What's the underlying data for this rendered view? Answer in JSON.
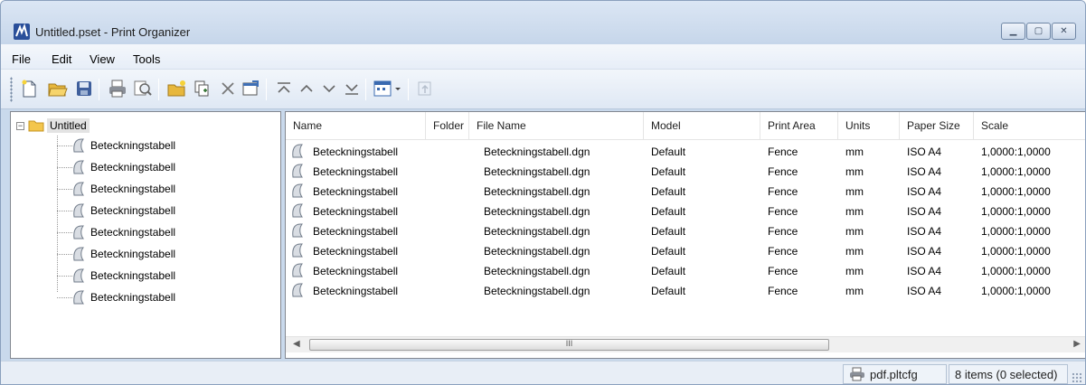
{
  "window": {
    "title": "Untitled.pset - Print Organizer"
  },
  "menu": [
    "File",
    "Edit",
    "View",
    "Tools"
  ],
  "toolbar": {
    "icons": [
      "new-file-icon",
      "open-folder-icon",
      "save-icon",
      "print-icon",
      "preview-icon",
      "add-folder-icon",
      "add-files-icon",
      "delete-icon",
      "properties-icon",
      "move-top-icon",
      "move-up-icon",
      "move-down-icon",
      "move-bottom-icon",
      "view-options-icon",
      "up-level-icon"
    ]
  },
  "tree": {
    "root": "Untitled",
    "children": [
      "Beteckningstabell",
      "Beteckningstabell",
      "Beteckningstabell",
      "Beteckningstabell",
      "Beteckningstabell",
      "Beteckningstabell",
      "Beteckningstabell",
      "Beteckningstabell"
    ]
  },
  "list": {
    "columns": [
      "Name",
      "Folder",
      "File Name",
      "Model",
      "Print Area",
      "Units",
      "Paper Size",
      "Scale"
    ],
    "rows": [
      {
        "name": "Beteckningstabell",
        "folder": "",
        "file": "Beteckningstabell.dgn",
        "model": "Default",
        "area": "Fence",
        "units": "mm",
        "paper": "ISO A4",
        "scale": "1,0000:1,0000"
      },
      {
        "name": "Beteckningstabell",
        "folder": "",
        "file": "Beteckningstabell.dgn",
        "model": "Default",
        "area": "Fence",
        "units": "mm",
        "paper": "ISO A4",
        "scale": "1,0000:1,0000"
      },
      {
        "name": "Beteckningstabell",
        "folder": "",
        "file": "Beteckningstabell.dgn",
        "model": "Default",
        "area": "Fence",
        "units": "mm",
        "paper": "ISO A4",
        "scale": "1,0000:1,0000"
      },
      {
        "name": "Beteckningstabell",
        "folder": "",
        "file": "Beteckningstabell.dgn",
        "model": "Default",
        "area": "Fence",
        "units": "mm",
        "paper": "ISO A4",
        "scale": "1,0000:1,0000"
      },
      {
        "name": "Beteckningstabell",
        "folder": "",
        "file": "Beteckningstabell.dgn",
        "model": "Default",
        "area": "Fence",
        "units": "mm",
        "paper": "ISO A4",
        "scale": "1,0000:1,0000"
      },
      {
        "name": "Beteckningstabell",
        "folder": "",
        "file": "Beteckningstabell.dgn",
        "model": "Default",
        "area": "Fence",
        "units": "mm",
        "paper": "ISO A4",
        "scale": "1,0000:1,0000"
      },
      {
        "name": "Beteckningstabell",
        "folder": "",
        "file": "Beteckningstabell.dgn",
        "model": "Default",
        "area": "Fence",
        "units": "mm",
        "paper": "ISO A4",
        "scale": "1,0000:1,0000"
      },
      {
        "name": "Beteckningstabell",
        "folder": "",
        "file": "Beteckningstabell.dgn",
        "model": "Default",
        "area": "Fence",
        "units": "mm",
        "paper": "ISO A4",
        "scale": "1,0000:1,0000"
      }
    ],
    "scroll_thumb_label": "III"
  },
  "status": {
    "printer_config": "pdf.pltcfg",
    "selection": "8 items (0 selected)"
  },
  "colors": {
    "accent": "#2a4f9a",
    "folder": "#f3c64d",
    "chrome": "#c9d9ec"
  }
}
